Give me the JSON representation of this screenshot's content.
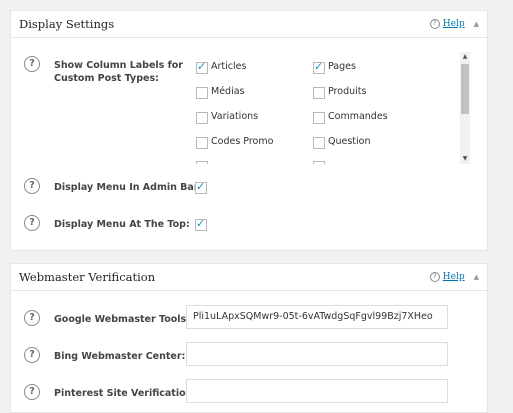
{
  "display_settings": {
    "title": "Display Settings",
    "help_label": "Help",
    "show_column_labels": {
      "label": "Show Column Labels for Custom Post Types:",
      "options": [
        {
          "label": "Articles",
          "checked": true
        },
        {
          "label": "Pages",
          "checked": true
        },
        {
          "label": "Médias",
          "checked": false
        },
        {
          "label": "Produits",
          "checked": false
        },
        {
          "label": "Variations",
          "checked": false
        },
        {
          "label": "Commandes",
          "checked": false
        },
        {
          "label": "Codes Promo",
          "checked": false
        },
        {
          "label": "Question",
          "checked": false
        }
      ]
    },
    "menu_admin_bar": {
      "label": "Display Menu In Admin Bar:",
      "checked": true
    },
    "menu_top": {
      "label": "Display Menu At The Top:",
      "checked": true
    }
  },
  "webmaster_verification": {
    "title": "Webmaster Verification",
    "help_label": "Help",
    "google": {
      "label": "Google Webmaster Tools:",
      "value": "Pli1uLApxSQMwr9-05t-6vATwdgSqFgvl99Bzj7XHeo"
    },
    "bing": {
      "label": "Bing Webmaster Center:",
      "value": ""
    },
    "pinterest": {
      "label": "Pinterest Site Verification:",
      "value": ""
    }
  },
  "icons": {
    "help": "question-circle-icon",
    "collapse": "triangle-up-icon",
    "check": "check-icon"
  },
  "colors": {
    "link": "#0073aa",
    "checkmark": "#1e8cbe",
    "background": "#f1f1f1"
  }
}
